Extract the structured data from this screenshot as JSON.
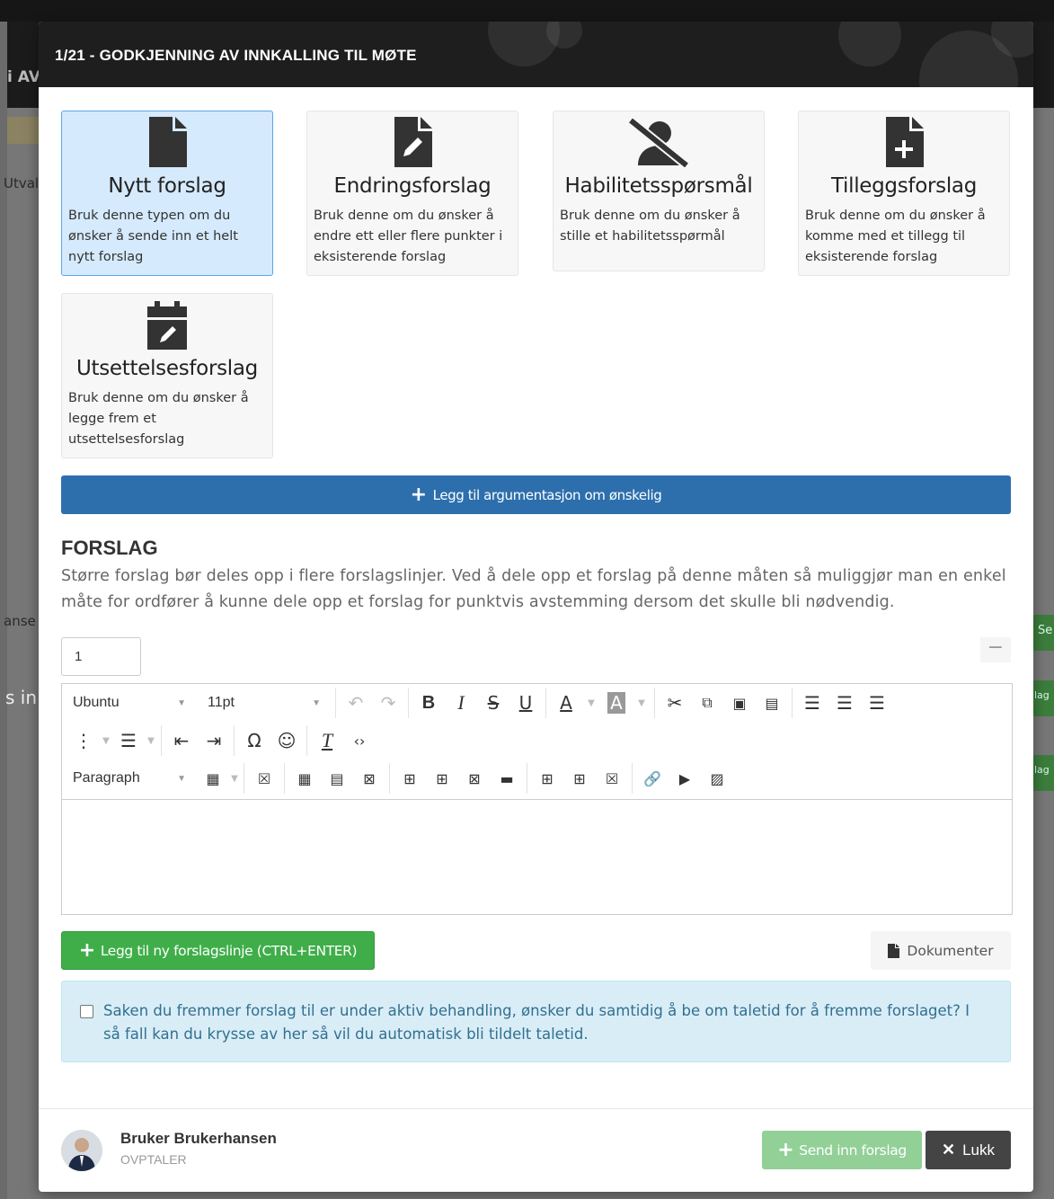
{
  "background": {
    "header_fragment": "i AV",
    "side_fragments": [
      "Utval",
      "anse",
      "s in"
    ],
    "right_fragments": [
      "Se",
      "lag",
      "lag"
    ]
  },
  "modal": {
    "title": "1/21 - GODKJENNING AV INNKALLING TIL MØTE"
  },
  "types": [
    {
      "name": "Nytt forslag",
      "desc": "Bruk denne typen om du ønsker å sende inn et helt nytt forslag",
      "icon": "file-icon",
      "selected": true
    },
    {
      "name": "Endringsforslag",
      "desc": "Bruk denne om du ønsker å endre ett eller flere punkter i eksisterende forslag",
      "icon": "file-edit-icon",
      "selected": false
    },
    {
      "name": "Habilitetsspørsmål",
      "desc": "Bruk denne om du ønsker å stille et habilitetsspørmål",
      "icon": "user-slash-icon",
      "selected": false
    },
    {
      "name": "Tilleggsforslag",
      "desc": "Bruk denne om du ønsker å komme med et tillegg til eksisterende forslag",
      "icon": "file-plus-icon",
      "selected": false
    },
    {
      "name": "Utsettelsesforslag",
      "desc": "Bruk denne om du ønsker å legge frem et utsettelsesforslag",
      "icon": "calendar-edit-icon",
      "selected": false
    }
  ],
  "argument_button": "Legg til argumentasjon om ønskelig",
  "forslag": {
    "title": "FORSLAG",
    "description": "Større forslag bør deles opp i flere forslagslinjer. Ved å dele opp et forslag på denne måten så muliggjør man en enkel måte for ordfører å kunne dele opp et forslag for punktvis avstemming dersom det skulle bli nødvendig.",
    "line_number": "1",
    "minus": "−"
  },
  "editor": {
    "font_family": "Ubuntu",
    "font_size": "11pt",
    "block_format": "Paragraph",
    "content": ""
  },
  "add_line_button": "Legg til ny forslagslinje (CTRL+ENTER)",
  "documents_button": "Dokumenter",
  "speak_request": {
    "checked": false,
    "text": "Saken du fremmer forslag til er under aktiv behandling, ønsker du samtidig å be om taletid for å fremme forslaget? I så fall kan du krysse av her så vil du automatisk bli tildelt taletid."
  },
  "footer": {
    "user_name": "Bruker Brukerhansen",
    "user_role": "OVPTALER",
    "send_button": "Send inn forslag",
    "close_button": "Lukk"
  },
  "colors": {
    "header_bg": "#1e1e1e",
    "selected_card_bg": "#d5eafc",
    "selected_card_border": "#5aa7e8",
    "primary_blue": "#2d6fad",
    "success_green": "#3fae49",
    "disabled_green": "#92d097",
    "info_bg": "#d9edf7",
    "info_text": "#31708f",
    "dark_button": "#444444"
  }
}
